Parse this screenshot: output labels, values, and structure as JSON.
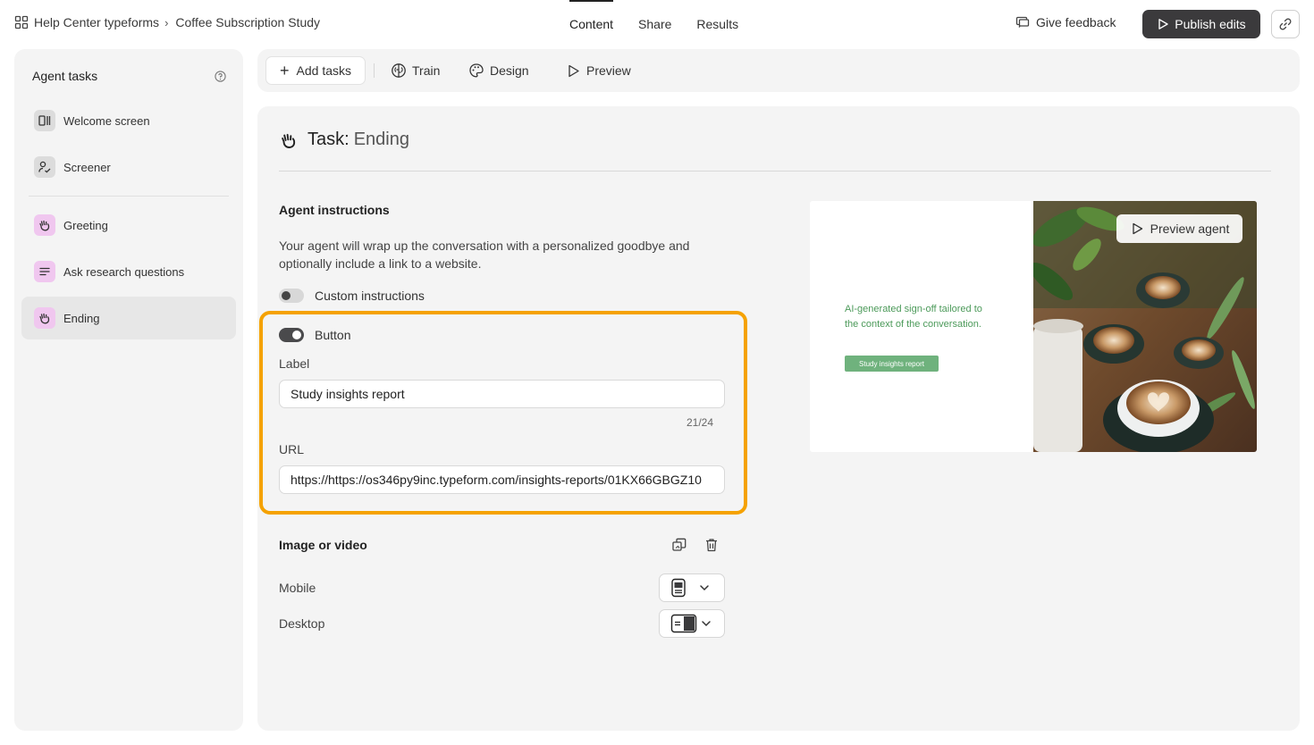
{
  "breadcrumb": {
    "workspace": "Help Center typeforms",
    "separator": "›",
    "study": "Coffee Subscription Study"
  },
  "nav_tabs": [
    {
      "label": "Content",
      "active": true
    },
    {
      "label": "Share",
      "active": false
    },
    {
      "label": "Results",
      "active": false
    }
  ],
  "header": {
    "feedback_label": "Give feedback",
    "publish_label": "Publish edits"
  },
  "sidebar": {
    "title": "Agent tasks",
    "items": [
      {
        "label": "Welcome screen",
        "icon": "welcome-screen-icon"
      },
      {
        "label": "Screener",
        "icon": "user-check-icon"
      },
      {
        "label": "Greeting",
        "icon": "waving-hand-icon"
      },
      {
        "label": "Ask research questions",
        "icon": "lines-icon"
      },
      {
        "label": "Ending",
        "icon": "waving-hand-icon",
        "active": true
      }
    ]
  },
  "toolbar": {
    "add_tasks": "Add tasks",
    "train": "Train",
    "design": "Design",
    "preview": "Preview"
  },
  "task": {
    "prefix": "Task:",
    "name": "Ending",
    "instructions_title": "Agent instructions",
    "instructions_desc": "Your agent will wrap up the conversation with a personalized goodbye and optionally include a link to a website.",
    "custom_instructions_label": "Custom instructions",
    "custom_instructions_on": false,
    "button_toggle_label": "Button",
    "button_toggle_on": true,
    "label_field_label": "Label",
    "label_value": "Study insights report",
    "label_counter": "21/24",
    "url_field_label": "URL",
    "url_value": "https://https://os346py9inc.typeform.com/insights-reports/01KX66GBGZ10",
    "media_title": "Image or video",
    "mobile_label": "Mobile",
    "desktop_label": "Desktop"
  },
  "preview": {
    "text": "AI-generated sign-off tailored to the context of the conversation.",
    "button_text": "Study insights report",
    "agent_label": "Preview agent"
  },
  "colors": {
    "highlight": "#f5a200",
    "accent_green": "#4c9a5a",
    "publish_bg": "#3b3a3c"
  }
}
